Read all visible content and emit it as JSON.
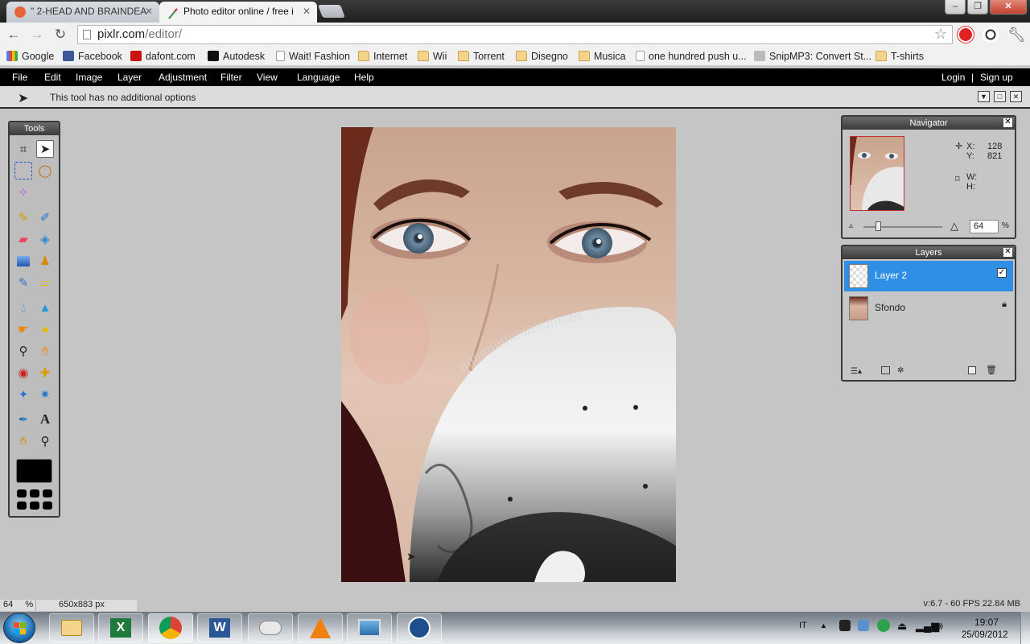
{
  "browser": {
    "tabs": [
      {
        "label": "\" 2-HEAD AND BRAINDEA",
        "active": false
      },
      {
        "label": "Photo editor online / free i",
        "active": true
      }
    ],
    "url_host": "pixlr.com",
    "url_path": "/editor/",
    "bookmarks": [
      {
        "label": "Google",
        "icon": "google-icon"
      },
      {
        "label": "Facebook",
        "icon": "facebook-icon"
      },
      {
        "label": "dafont.com",
        "icon": "dafont-icon"
      },
      {
        "label": "Autodesk",
        "icon": "autodesk-icon"
      },
      {
        "label": "Wait! Fashion",
        "icon": "page-icon"
      },
      {
        "label": "Internet",
        "icon": "folder-icon"
      },
      {
        "label": "Wii",
        "icon": "folder-icon"
      },
      {
        "label": "Torrent",
        "icon": "folder-icon"
      },
      {
        "label": "Disegno",
        "icon": "folder-icon"
      },
      {
        "label": "Musica",
        "icon": "folder-icon"
      },
      {
        "label": "one hundred push u...",
        "icon": "page-icon"
      },
      {
        "label": "SnipMP3: Convert St...",
        "icon": "snipmp3-icon"
      },
      {
        "label": "T-shirts",
        "icon": "folder-icon"
      }
    ]
  },
  "editor": {
    "menu": [
      "File",
      "Edit",
      "Image",
      "Layer",
      "Adjustment",
      "Filter",
      "View",
      "Language",
      "Help"
    ],
    "login": "Login",
    "separator": "|",
    "signup": "Sign up",
    "options_message": "This tool has no additional options",
    "tools_title": "Tools",
    "navigator": {
      "title": "Navigator",
      "x_label": "X:",
      "x_value": "128",
      "y_label": "Y:",
      "y_value": "821",
      "w_label": "W:",
      "h_label": "H:",
      "zoom_value": "64",
      "zoom_unit": "%",
      "zoom_level": 0.18
    },
    "layers": {
      "title": "Layers",
      "items": [
        {
          "name": "Layer 2",
          "selected": true,
          "visible": true
        },
        {
          "name": "Sfondo",
          "selected": false,
          "locked": true
        }
      ]
    },
    "status": {
      "zoom": "64",
      "zoom_unit": "%",
      "dimensions": "650x883 px",
      "perf": "v:6.7 - 60 FPS 22.84 MB"
    }
  },
  "taskbar": {
    "items": [
      "explorer-icon",
      "excel-icon",
      "chrome-icon",
      "word-icon",
      "usb-icon",
      "vlc-icon",
      "photo-viewer-icon",
      "camera-icon"
    ],
    "language": "IT",
    "time": "19:07",
    "date": "25/09/2012"
  },
  "colors": {
    "selection": "#2e8fe4",
    "menu_bar": "#000000",
    "panel_bg": "#c6c6c6"
  }
}
